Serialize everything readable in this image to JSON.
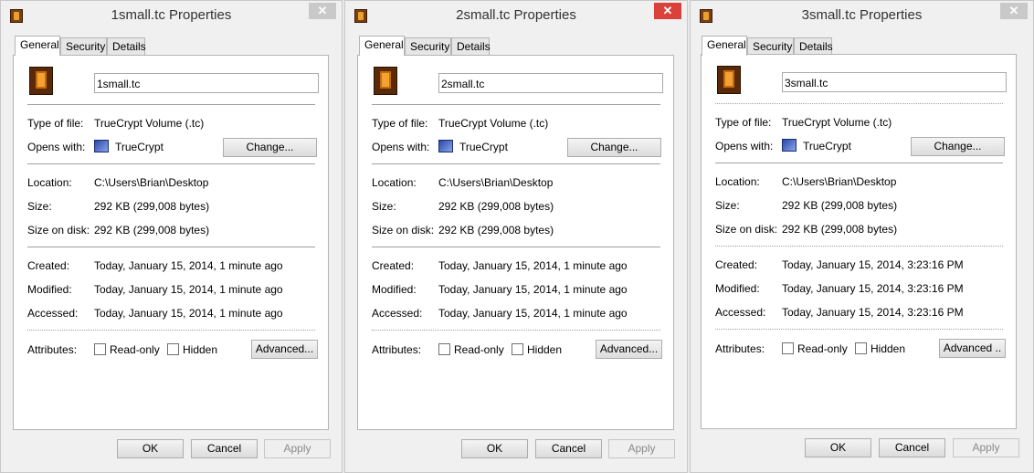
{
  "dialogs": [
    {
      "title": "1small.tc Properties",
      "tabs": [
        "General",
        "Security",
        "Details"
      ],
      "file_name": "1small.tc",
      "type_label": "Type of file:",
      "type_value": "TrueCrypt Volume (.tc)",
      "opens_label": "Opens with:",
      "opens_value": "TrueCrypt",
      "change_label": "Change...",
      "location_label": "Location:",
      "location_value": "C:\\Users\\Brian\\Desktop",
      "size_label": "Size:",
      "size_value": "292 KB (299,008 bytes)",
      "size_on_disk_label": "Size on disk:",
      "size_on_disk_value": "292 KB (299,008 bytes)",
      "created_label": "Created:",
      "created_value": "Today, January 15, 2014, 1 minute ago",
      "modified_label": "Modified:",
      "modified_value": "Today, January 15, 2014, 1 minute ago",
      "accessed_label": "Accessed:",
      "accessed_value": "Today, January 15, 2014, 1 minute ago",
      "attributes_label": "Attributes:",
      "readonly_label": "Read-only",
      "hidden_label": "Hidden",
      "advanced_label": "Advanced...",
      "ok_label": "OK",
      "cancel_label": "Cancel",
      "apply_label": "Apply"
    },
    {
      "title": "2small.tc Properties",
      "tabs": [
        "General",
        "Security",
        "Details"
      ],
      "file_name": "2small.tc",
      "type_label": "Type of file:",
      "type_value": "TrueCrypt Volume (.tc)",
      "opens_label": "Opens with:",
      "opens_value": "TrueCrypt",
      "change_label": "Change...",
      "location_label": "Location:",
      "location_value": "C:\\Users\\Brian\\Desktop",
      "size_label": "Size:",
      "size_value": "292 KB (299,008 bytes)",
      "size_on_disk_label": "Size on disk:",
      "size_on_disk_value": "292 KB (299,008 bytes)",
      "created_label": "Created:",
      "created_value": "Today, January 15, 2014, 1 minute ago",
      "modified_label": "Modified:",
      "modified_value": "Today, January 15, 2014, 1 minute ago",
      "accessed_label": "Accessed:",
      "accessed_value": "Today, January 15, 2014, 1 minute ago",
      "attributes_label": "Attributes:",
      "readonly_label": "Read-only",
      "hidden_label": "Hidden",
      "advanced_label": "Advanced...",
      "ok_label": "OK",
      "cancel_label": "Cancel",
      "apply_label": "Apply"
    },
    {
      "title": "3small.tc Properties",
      "tabs": [
        "General",
        "Security",
        "Details"
      ],
      "file_name": "3small.tc",
      "type_label": "Type of file:",
      "type_value": "TrueCrypt Volume (.tc)",
      "opens_label": "Opens with:",
      "opens_value": "TrueCrypt",
      "change_label": "Change...",
      "location_label": "Location:",
      "location_value": "C:\\Users\\Brian\\Desktop",
      "size_label": "Size:",
      "size_value": "292 KB (299,008 bytes)",
      "size_on_disk_label": "Size on disk:",
      "size_on_disk_value": "292 KB (299,008 bytes)",
      "created_label": "Created:",
      "created_value": "Today, January 15, 2014, 3:23:16 PM",
      "modified_label": "Modified:",
      "modified_value": "Today, January 15, 2014, 3:23:16 PM",
      "accessed_label": "Accessed:",
      "accessed_value": "Today, January 15, 2014, 3:23:16 PM",
      "attributes_label": "Attributes:",
      "readonly_label": "Read-only",
      "hidden_label": "Hidden",
      "advanced_label": "Advanced ..",
      "ok_label": "OK",
      "cancel_label": "Cancel",
      "apply_label": "Apply"
    }
  ],
  "close_glyph": "✕",
  "colors": {
    "close_active": "#d9413a",
    "close_inactive": "#c9c9c9",
    "dialog_bg": "#f0f0f0",
    "panel_bg": "#ffffff",
    "disabled_text": "#8a8a8a"
  },
  "icons": {
    "app": "truecrypt-volume-icon",
    "opens_with": "truecrypt-app-icon",
    "close": "close-icon"
  }
}
